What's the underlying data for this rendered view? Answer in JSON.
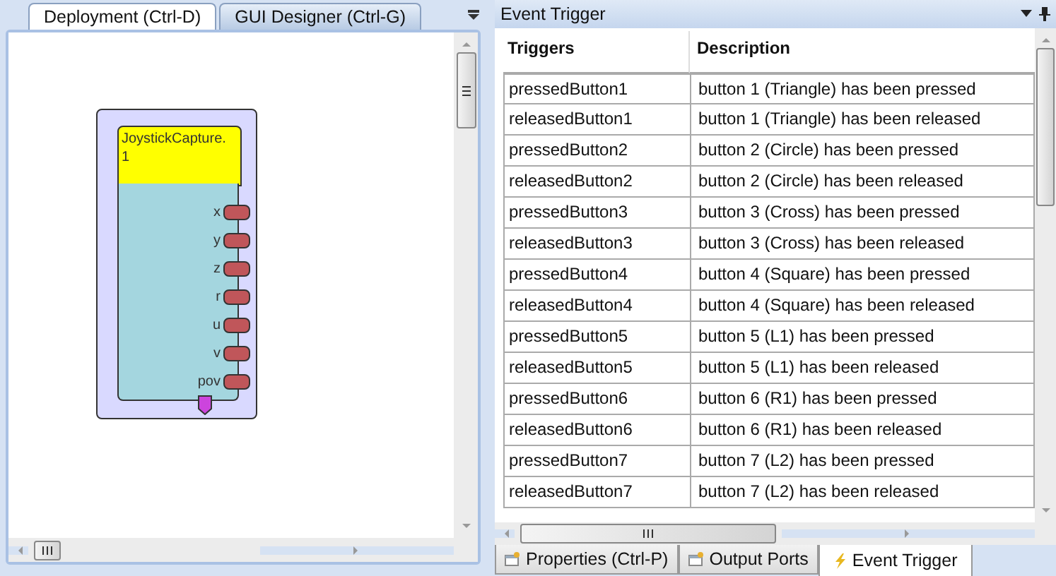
{
  "left_panel": {
    "tabs": [
      {
        "label": "Deployment (Ctrl-D)",
        "selected": true
      },
      {
        "label": "GUI Designer (Ctrl-G)",
        "selected": false
      }
    ],
    "component": {
      "title": "JoystickCapture.\n1",
      "ports": [
        "x",
        "y",
        "z",
        "r",
        "u",
        "v",
        "pov"
      ]
    }
  },
  "right_panel": {
    "title": "Event Trigger",
    "table": {
      "columns": [
        "Triggers",
        "Description"
      ],
      "rows": [
        [
          "pressedButton1",
          "button 1 (Triangle) has been pressed"
        ],
        [
          "releasedButton1",
          "button 1 (Triangle) has been released"
        ],
        [
          "pressedButton2",
          "button 2 (Circle) has been pressed"
        ],
        [
          "releasedButton2",
          "button 2 (Circle) has been released"
        ],
        [
          "pressedButton3",
          "button 3 (Cross) has been pressed"
        ],
        [
          "releasedButton3",
          "button 3 (Cross) has been released"
        ],
        [
          "pressedButton4",
          "button 4 (Square) has been pressed"
        ],
        [
          "releasedButton4",
          "button 4 (Square) has been released"
        ],
        [
          "pressedButton5",
          "button 5 (L1) has been pressed"
        ],
        [
          "releasedButton5",
          "button 5 (L1) has been released"
        ],
        [
          "pressedButton6",
          "button 6 (R1) has been pressed"
        ],
        [
          "releasedButton6",
          "button 6 (R1) has been released"
        ],
        [
          "pressedButton7",
          "button 7 (L2) has been pressed"
        ],
        [
          "releasedButton7",
          "button 7 (L2) has been released"
        ]
      ]
    },
    "bottom_tabs": [
      {
        "label": "Properties (Ctrl-P)",
        "kind": "props",
        "selected": false
      },
      {
        "label": "Output Ports",
        "kind": "props",
        "selected": false
      },
      {
        "label": "Event Trigger",
        "kind": "bolt",
        "selected": true
      }
    ]
  }
}
